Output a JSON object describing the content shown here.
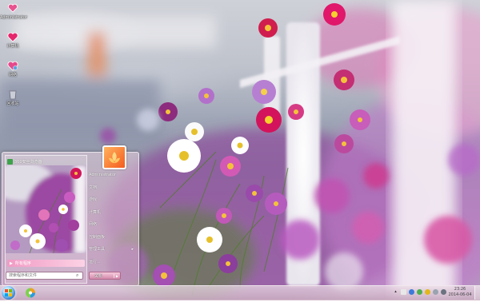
{
  "desktop": {
    "icons": [
      {
        "name": "folder-heart-icon",
        "label": "Administrator"
      },
      {
        "name": "computer-heart-icon",
        "label": "计算机"
      },
      {
        "name": "network-heart-icon",
        "label": "网络"
      },
      {
        "name": "recycle-bin-icon",
        "label": "回收站"
      }
    ]
  },
  "start_menu": {
    "pinned": [
      {
        "label": "360安全浏览器",
        "icon": "browser-icon"
      }
    ],
    "all_programs": "所有程序",
    "search_placeholder": "搜索程序和文件",
    "user_name": "Administrator",
    "right_items": [
      {
        "label": "文档"
      },
      {
        "label": "游戏"
      },
      {
        "label": "计算机"
      },
      {
        "label": "网络"
      },
      {
        "label": "控制面板"
      },
      {
        "label": "管理工具",
        "has_submenu": true
      },
      {
        "label": "运行..."
      }
    ],
    "shutdown": "关机"
  },
  "taskbar": {
    "clock_time": "23:26",
    "clock_date": "2014-06-04",
    "tray_icons": [
      "chevron-up-icon",
      "keyboard-icon",
      "ime-icon",
      "speaker-icon",
      "network-icon",
      "shield-icon",
      "flag-icon"
    ]
  },
  "colors": {
    "start_menu_accent": "#f19ac4",
    "taskbar_tint": "#d9b7c9"
  }
}
